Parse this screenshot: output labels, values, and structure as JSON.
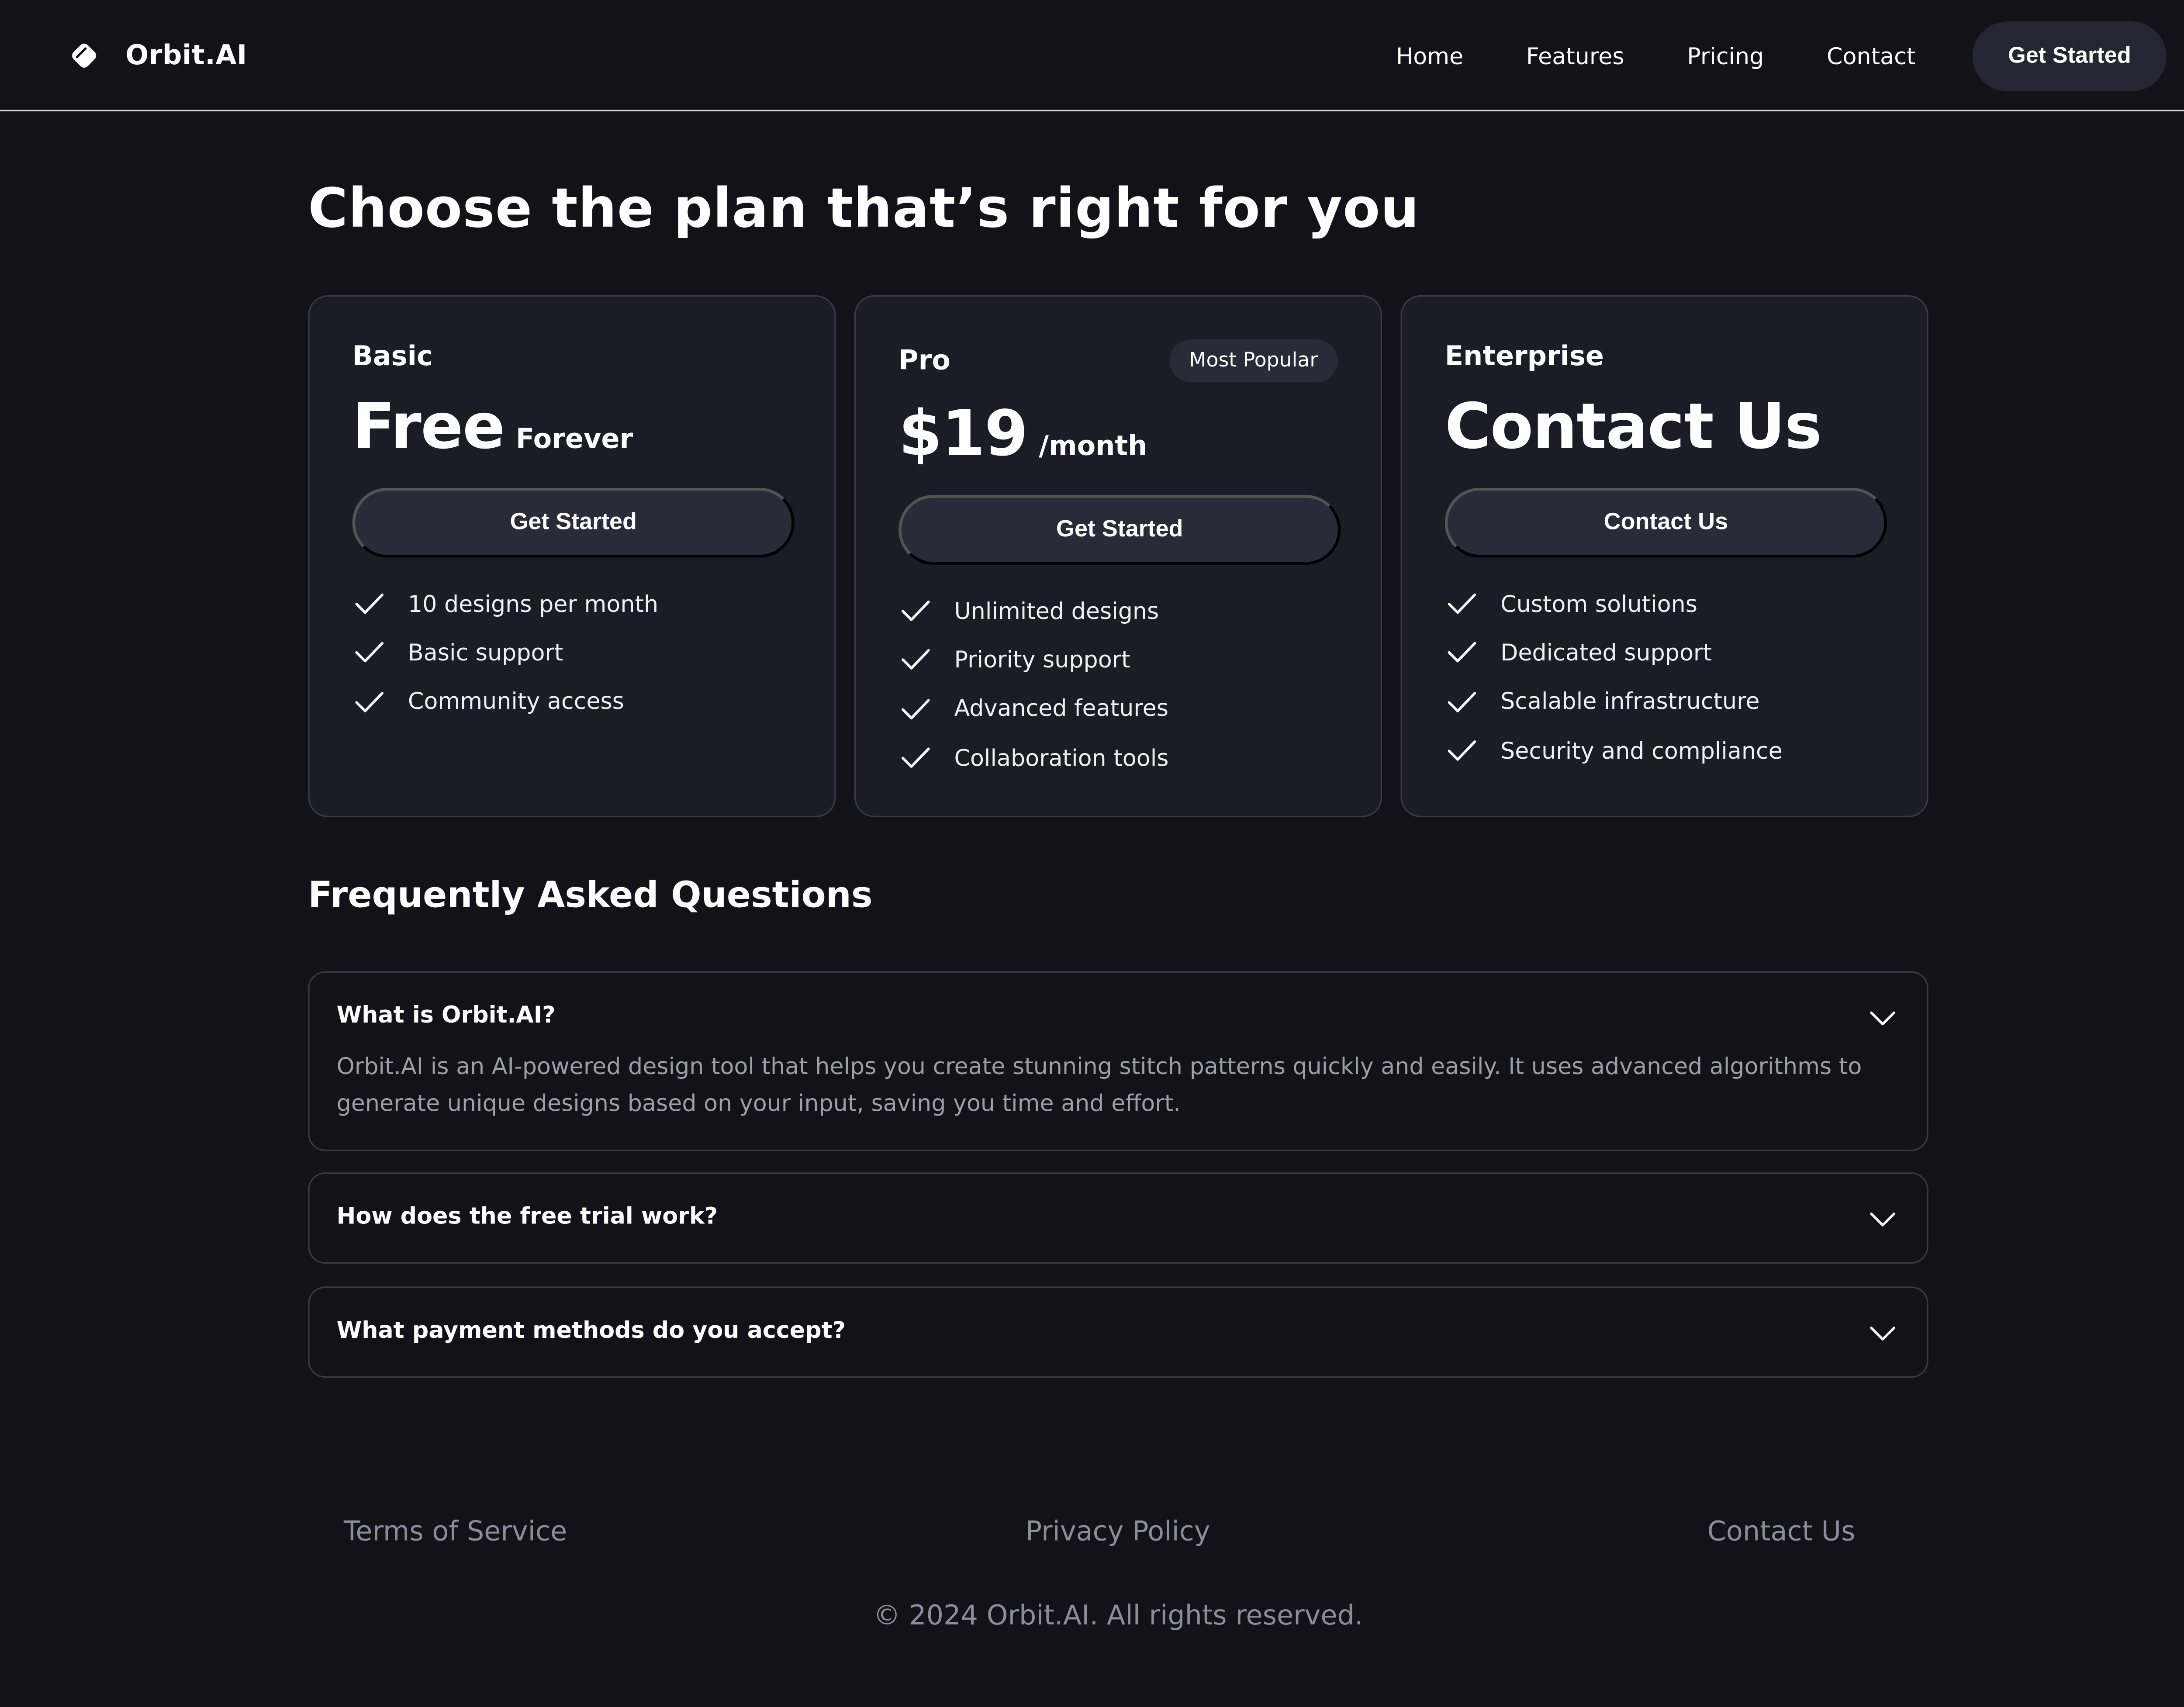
{
  "brand": {
    "name": "Orbit.AI",
    "logo_icon": "diamond-logo-icon"
  },
  "nav": {
    "links": [
      "Home",
      "Features",
      "Pricing",
      "Contact"
    ],
    "cta": "Get Started"
  },
  "pricing": {
    "title": "Choose the plan that’s right for you",
    "plans": [
      {
        "name": "Basic",
        "price": "Free",
        "period": "Forever",
        "button": "Get Started",
        "features": [
          "10 designs per month",
          "Basic support",
          "Community access"
        ]
      },
      {
        "name": "Pro",
        "badge": "Most Popular",
        "price": "$19",
        "period": "/month",
        "button": "Get Started",
        "features": [
          "Unlimited designs",
          "Priority support",
          "Advanced features",
          "Collaboration tools"
        ]
      },
      {
        "name": "Enterprise",
        "price": "Contact Us",
        "button": "Contact Us",
        "features": [
          "Custom solutions",
          "Dedicated support",
          "Scalable infrastructure",
          "Security and compliance"
        ]
      }
    ]
  },
  "faq": {
    "title": "Frequently Asked Questions",
    "items": [
      {
        "question": "What is Orbit.AI?",
        "answer": "Orbit.AI is an AI-powered design tool that helps you create stunning stitch patterns quickly and easily. It uses advanced algorithms to generate unique designs based on your input, saving you time and effort.",
        "expanded": true
      },
      {
        "question": "How does the free trial work?",
        "expanded": false
      },
      {
        "question": "What payment methods do you accept?",
        "expanded": false
      }
    ]
  },
  "footer": {
    "links": [
      "Terms of Service",
      "Privacy Policy",
      "Contact Us"
    ],
    "copyright": "© 2024 Orbit.AI. All rights reserved."
  },
  "colors": {
    "background": "#131218",
    "card": "#1c1c27",
    "button": "#2a2a38",
    "border": "#3a3a48",
    "muted_text": "#9e9eab"
  }
}
